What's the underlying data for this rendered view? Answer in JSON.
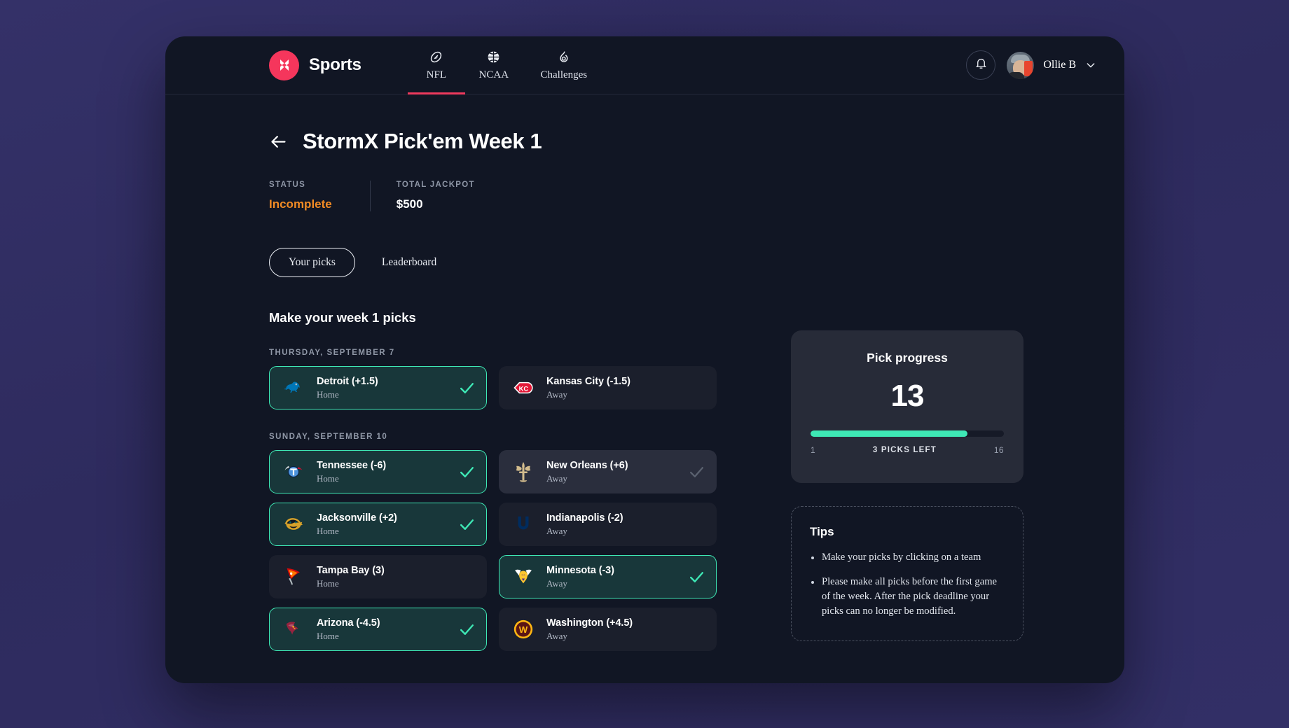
{
  "header": {
    "brand_name": "Sports",
    "logo_icon": "x-logo-icon",
    "nav": [
      {
        "label": "NFL",
        "icon": "football-icon",
        "active": true
      },
      {
        "label": "NCAA",
        "icon": "basketball-icon",
        "active": false
      },
      {
        "label": "Challenges",
        "icon": "flame-icon",
        "active": false
      }
    ],
    "notification_icon": "bell-icon",
    "user_name": "Ollie B",
    "user_chevron_icon": "chevron-down-icon"
  },
  "page": {
    "back_icon": "arrow-left-icon",
    "title": "StormX Pick'em Week 1",
    "meta": [
      {
        "label": "STATUS",
        "value": "Incomplete",
        "accent": true
      },
      {
        "label": "TOTAL JACKPOT",
        "value": "$500",
        "accent": false
      }
    ],
    "tabs": [
      {
        "label": "Your picks",
        "active": true
      },
      {
        "label": "Leaderboard",
        "active": false
      }
    ],
    "section_title": "Make your week 1 picks"
  },
  "days": [
    {
      "label": "THURSDAY, SEPTEMBER 7",
      "games": [
        {
          "home": {
            "team": "Detroit (+1.5)",
            "side": "Home",
            "logo": "detroit-lions-logo",
            "selected": true,
            "hovered": false
          },
          "away": {
            "team": "Kansas City (-1.5)",
            "side": "Away",
            "logo": "kansas-city-chiefs-logo",
            "selected": false,
            "hovered": false
          }
        }
      ]
    },
    {
      "label": "SUNDAY, SEPTEMBER 10",
      "games": [
        {
          "home": {
            "team": "Tennessee (-6)",
            "side": "Home",
            "logo": "tennessee-titans-logo",
            "selected": true,
            "hovered": false
          },
          "away": {
            "team": "New Orleans (+6)",
            "side": "Away",
            "logo": "new-orleans-saints-logo",
            "selected": false,
            "hovered": true
          }
        },
        {
          "home": {
            "team": "Jacksonville (+2)",
            "side": "Home",
            "logo": "jacksonville-jaguars-logo",
            "selected": true,
            "hovered": false
          },
          "away": {
            "team": "Indianapolis (-2)",
            "side": "Away",
            "logo": "indianapolis-colts-logo",
            "selected": false,
            "hovered": false
          }
        },
        {
          "home": {
            "team": "Tampa Bay (3)",
            "side": "Home",
            "logo": "tampa-bay-buccaneers-logo",
            "selected": false,
            "hovered": false
          },
          "away": {
            "team": "Minnesota (-3)",
            "side": "Away",
            "logo": "minnesota-vikings-logo",
            "selected": true,
            "hovered": false
          }
        },
        {
          "home": {
            "team": "Arizona (-4.5)",
            "side": "Home",
            "logo": "arizona-cardinals-logo",
            "selected": true,
            "hovered": false
          },
          "away": {
            "team": "Washington (+4.5)",
            "side": "Away",
            "logo": "washington-commanders-logo",
            "selected": false,
            "hovered": false
          }
        }
      ]
    }
  ],
  "progress": {
    "heading": "Pick progress",
    "count": "13",
    "min_label": "1",
    "max_label": "16",
    "remaining_label": "3 PICKS LEFT",
    "fill_percent": 81,
    "fill_color": "#3ee8b5"
  },
  "tips": {
    "heading": "Tips",
    "items": [
      "Make your picks by clicking on a team",
      "Please make all picks before the first game of the week. After the pick deadline your picks can no longer be modified."
    ]
  },
  "colors": {
    "accent_mint": "#3ee8b5",
    "brand_red": "#f5365c",
    "status_orange": "#f08a24",
    "window_bg": "#111624",
    "page_bg": "#322f66"
  }
}
